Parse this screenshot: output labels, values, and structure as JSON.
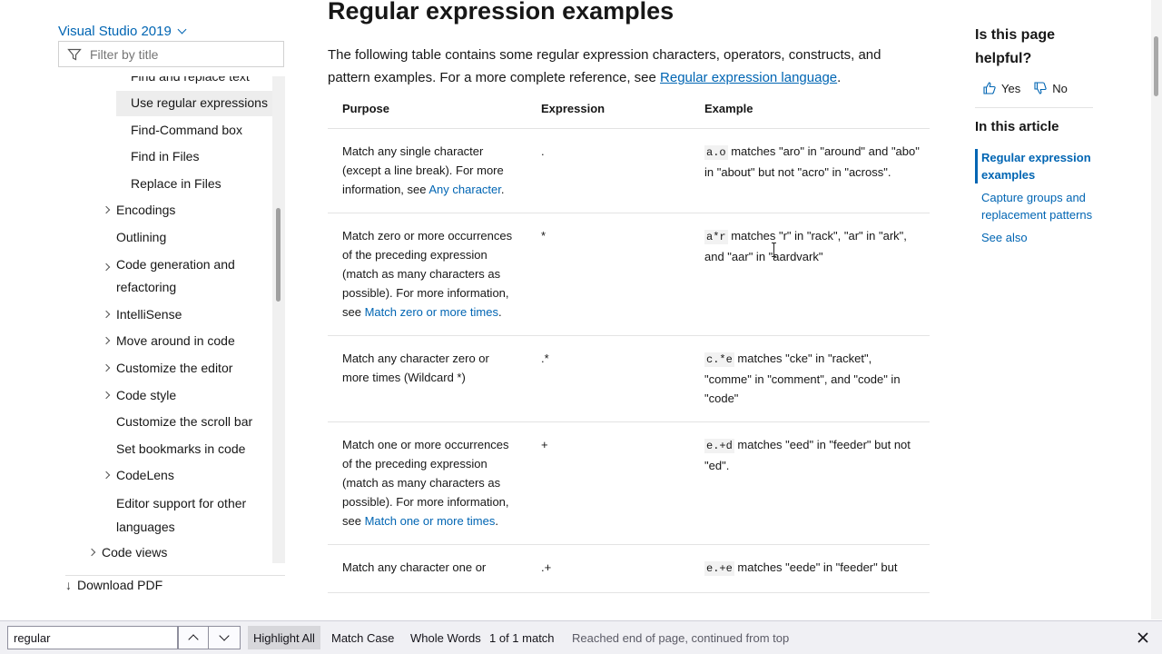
{
  "sidebar": {
    "version": "Visual Studio 2019",
    "filter_placeholder": "Filter by title",
    "items": [
      {
        "label": "Find and replace text",
        "level": 2
      },
      {
        "label": "Use regular expressions",
        "level": 2,
        "selected": true
      },
      {
        "label": "Find-Command box",
        "level": 2
      },
      {
        "label": "Find in Files",
        "level": 2
      },
      {
        "label": "Replace in Files",
        "level": 2
      },
      {
        "label": "Encodings",
        "level": 1,
        "expandable": true
      },
      {
        "label": "Outlining",
        "level": 1
      },
      {
        "label": "Code generation and",
        "label2": "refactoring",
        "level": 1,
        "expandable": true
      },
      {
        "label": "IntelliSense",
        "level": 1,
        "expandable": true
      },
      {
        "label": "Move around in code",
        "level": 1,
        "expandable": true
      },
      {
        "label": "Customize the editor",
        "level": 1,
        "expandable": true
      },
      {
        "label": "Code style",
        "level": 1,
        "expandable": true
      },
      {
        "label": "Customize the scroll bar",
        "level": 1
      },
      {
        "label": "Set bookmarks in code",
        "level": 1
      },
      {
        "label": "CodeLens",
        "level": 1,
        "expandable": true
      },
      {
        "label": "Editor support for other",
        "label2": "languages",
        "level": 1
      },
      {
        "label": "Code views",
        "level": 0,
        "expandable": true
      }
    ],
    "download_pdf": "Download PDF"
  },
  "main": {
    "title": "Regular expression examples",
    "intro_text": "The following table contains some regular expression characters, operators, constructs, and pattern examples. For a more complete reference, see ",
    "intro_link": "Regular expression language",
    "intro_end": ".",
    "table": {
      "headers": [
        "Purpose",
        "Expression",
        "Example"
      ],
      "rows": [
        {
          "purpose": "Match any single character (except a line break). For more information, see ",
          "purpose_link": "Any character",
          "purpose_end": ".",
          "expression": ".",
          "example_code": "a.o",
          "example_text": " matches \"aro\" in \"around\" and \"abo\" in \"about\" but not \"acro\" in \"across\"."
        },
        {
          "purpose": "Match zero or more occurrences of the preceding expression (match as many characters as possible). For more information, see ",
          "purpose_link": "Match zero or more times",
          "purpose_end": ".",
          "expression": "*",
          "example_code": "a*r",
          "example_text": " matches \"r\" in \"rack\", \"ar\" in \"ark\", and \"aar\" in \"aardvark\""
        },
        {
          "purpose": "Match any character zero or more times (Wildcard *)",
          "purpose_link": "",
          "purpose_end": "",
          "expression": ".*",
          "example_code": "c.*e",
          "example_text": " matches \"cke\" in \"racket\", \"comme\" in \"comment\", and \"code\" in \"code\""
        },
        {
          "purpose": "Match one or more occurrences of the preceding expression (match as many characters as possible). For more information, see ",
          "purpose_link": "Match one or more times",
          "purpose_end": ".",
          "expression": "+",
          "example_code": "e.+d",
          "example_text": " matches \"eed\" in \"feeder\" but not \"ed\"."
        },
        {
          "purpose": "Match any character one or",
          "purpose_link": "",
          "purpose_end": "",
          "expression": ".+",
          "example_code": "e.+e",
          "example_text": " matches \"eede\" in \"feeder\" but"
        }
      ]
    }
  },
  "right_panel": {
    "helpful": "Is this page helpful?",
    "yes": "Yes",
    "no": "No",
    "in_this_article": "In this article",
    "links": [
      {
        "label": "Regular expression examples",
        "active": true
      },
      {
        "label": "Capture groups and replacement patterns",
        "active": false
      },
      {
        "label": "See also",
        "active": false
      }
    ]
  },
  "findbar": {
    "query": "regular",
    "highlight_all": "Highlight All",
    "match_case": "Match Case",
    "whole_words": "Whole Words",
    "match_count": "1 of 1 match",
    "status": "Reached end of page, continued from top"
  },
  "colors": {
    "link": "#0065b3",
    "selected_bg": "#ededed",
    "findbar_bg": "#f0f0f4"
  }
}
